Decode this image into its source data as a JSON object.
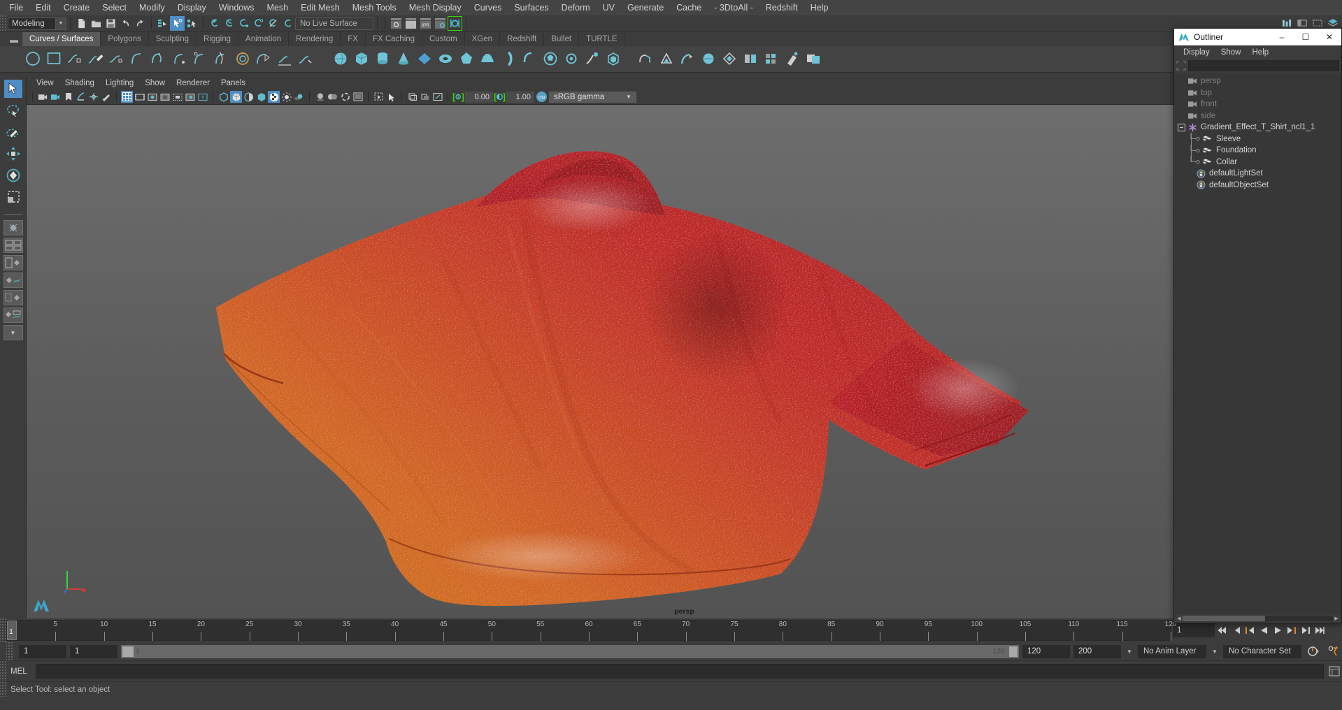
{
  "app": {
    "menubar": [
      "File",
      "Edit",
      "Create",
      "Select",
      "Modify",
      "Display",
      "Windows",
      "Mesh",
      "Edit Mesh",
      "Mesh Tools",
      "Mesh Display",
      "Curves",
      "Surfaces",
      "Deform",
      "UV",
      "Generate",
      "Cache",
      "- 3DtoAll -",
      "Redshift",
      "Help"
    ]
  },
  "toolbar": {
    "mode": "Modeling",
    "live_surface": "No Live Surface"
  },
  "shelf": {
    "tabs": [
      "Curves / Surfaces",
      "Polygons",
      "Sculpting",
      "Rigging",
      "Animation",
      "Rendering",
      "FX",
      "FX Caching",
      "Custom",
      "XGen",
      "Redshift",
      "Bullet",
      "TURTLE"
    ],
    "active_tab": "Curves / Surfaces"
  },
  "viewport": {
    "menus": [
      "View",
      "Shading",
      "Lighting",
      "Show",
      "Renderer",
      "Panels"
    ],
    "exposure": "0.00",
    "gamma": "1.00",
    "color_space": "sRGB gamma",
    "camera_label": "persp",
    "on_badge": "ON"
  },
  "outliner": {
    "title": "Outliner",
    "menus": [
      "Display",
      "Show",
      "Help"
    ],
    "search_value": "",
    "items": [
      {
        "label": "persp",
        "icon": "camera-icon",
        "depth": 1,
        "dim": true,
        "expander": "none"
      },
      {
        "label": "top",
        "icon": "camera-icon",
        "depth": 1,
        "dim": true,
        "expander": "none"
      },
      {
        "label": "front",
        "icon": "camera-icon",
        "depth": 1,
        "dim": true,
        "expander": "none"
      },
      {
        "label": "side",
        "icon": "camera-icon",
        "depth": 1,
        "dim": true,
        "expander": "none"
      },
      {
        "label": "Gradient_Effect_T_Shirt_ncl1_1",
        "icon": "asterisk-icon",
        "depth": 1,
        "dim": false,
        "expander": "minus"
      },
      {
        "label": "Sleeve",
        "icon": "mesh-icon",
        "depth": 2,
        "dim": false,
        "expander": "none"
      },
      {
        "label": "Foundation",
        "icon": "mesh-icon",
        "depth": 2,
        "dim": false,
        "expander": "none"
      },
      {
        "label": "Collar",
        "icon": "mesh-icon",
        "depth": 2,
        "dim": false,
        "expander": "none"
      },
      {
        "label": "defaultLightSet",
        "icon": "set-icon",
        "depth": 1.5,
        "dim": false,
        "expander": "none"
      },
      {
        "label": "defaultObjectSet",
        "icon": "set-icon",
        "depth": 1.5,
        "dim": false,
        "expander": "none"
      }
    ],
    "window_buttons": {
      "minimize": "–",
      "maximize": "☐",
      "close": "✕"
    }
  },
  "timeline": {
    "start_label": "1",
    "ticks": [
      5,
      10,
      15,
      20,
      25,
      30,
      35,
      40,
      45,
      50,
      55,
      60,
      65,
      70,
      75,
      80,
      85,
      90,
      95,
      100,
      105,
      110,
      115,
      120
    ],
    "current_frame": "1",
    "current_frame_field": "1",
    "range_start": "1",
    "range_end_slider": "1",
    "range_slider_right": "120",
    "playback_end": "120",
    "animation_end": "200",
    "anim_layer": "No Anim Layer",
    "character_set": "No Character Set"
  },
  "command": {
    "label": "MEL",
    "value": "",
    "status": "Select Tool: select an object"
  },
  "colors": {
    "accent_blue": "#4f8ec4",
    "accent_green": "#39d600",
    "panel_bg": "#3c3c3c",
    "viewport_bg": "#5f5f5f",
    "shirt_red": "#c4252c",
    "shirt_orange": "#d86a1e"
  }
}
